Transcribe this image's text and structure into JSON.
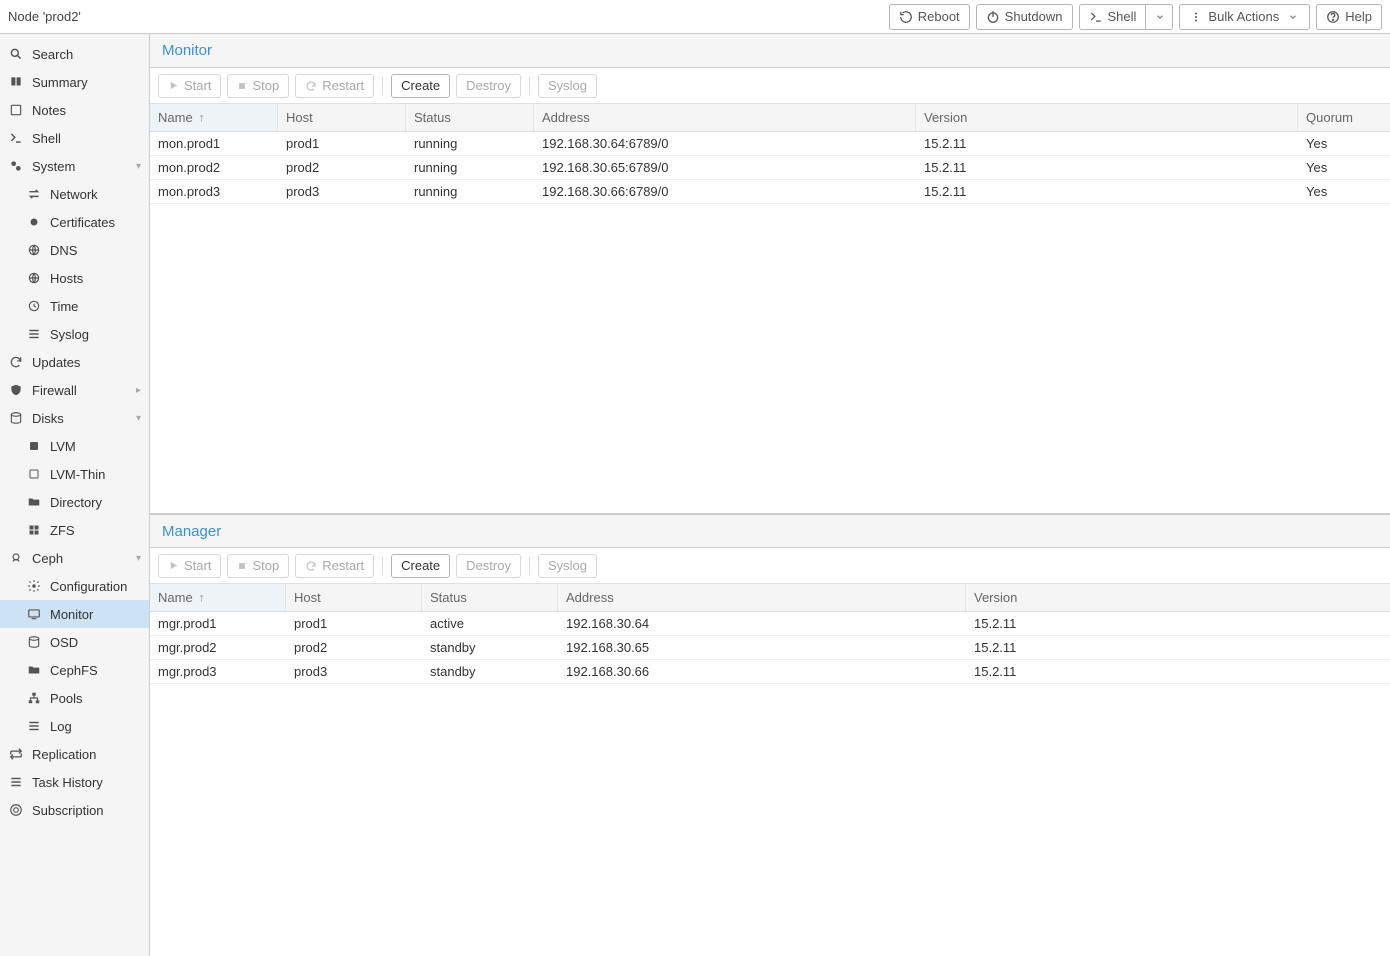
{
  "header": {
    "title": "Node 'prod2'",
    "reboot": "Reboot",
    "shutdown": "Shutdown",
    "shell": "Shell",
    "bulk": "Bulk Actions",
    "help": "Help"
  },
  "sidebar": {
    "search": "Search",
    "summary": "Summary",
    "notes": "Notes",
    "shell": "Shell",
    "system": "System",
    "network": "Network",
    "certificates": "Certificates",
    "dns": "DNS",
    "hosts": "Hosts",
    "time": "Time",
    "syslog": "Syslog",
    "updates": "Updates",
    "firewall": "Firewall",
    "disks": "Disks",
    "lvm": "LVM",
    "lvmthin": "LVM-Thin",
    "directory": "Directory",
    "zfs": "ZFS",
    "ceph": "Ceph",
    "configuration": "Configuration",
    "monitor": "Monitor",
    "osd": "OSD",
    "cephfs": "CephFS",
    "pools": "Pools",
    "log": "Log",
    "replication": "Replication",
    "taskhistory": "Task History",
    "subscription": "Subscription"
  },
  "monitor": {
    "title": "Monitor",
    "toolbar": {
      "start": "Start",
      "stop": "Stop",
      "restart": "Restart",
      "create": "Create",
      "destroy": "Destroy",
      "syslog": "Syslog"
    },
    "columns": {
      "name": "Name",
      "host": "Host",
      "status": "Status",
      "address": "Address",
      "version": "Version",
      "quorum": "Quorum"
    },
    "rows": [
      {
        "name": "mon.prod1",
        "host": "prod1",
        "status": "running",
        "address": "192.168.30.64:6789/0",
        "version": "15.2.11",
        "quorum": "Yes"
      },
      {
        "name": "mon.prod2",
        "host": "prod2",
        "status": "running",
        "address": "192.168.30.65:6789/0",
        "version": "15.2.11",
        "quorum": "Yes"
      },
      {
        "name": "mon.prod3",
        "host": "prod3",
        "status": "running",
        "address": "192.168.30.66:6789/0",
        "version": "15.2.11",
        "quorum": "Yes"
      }
    ]
  },
  "manager": {
    "title": "Manager",
    "toolbar": {
      "start": "Start",
      "stop": "Stop",
      "restart": "Restart",
      "create": "Create",
      "destroy": "Destroy",
      "syslog": "Syslog"
    },
    "columns": {
      "name": "Name",
      "host": "Host",
      "status": "Status",
      "address": "Address",
      "version": "Version"
    },
    "rows": [
      {
        "name": "mgr.prod1",
        "host": "prod1",
        "status": "active",
        "address": "192.168.30.64",
        "version": "15.2.11"
      },
      {
        "name": "mgr.prod2",
        "host": "prod2",
        "status": "standby",
        "address": "192.168.30.65",
        "version": "15.2.11"
      },
      {
        "name": "mgr.prod3",
        "host": "prod3",
        "status": "standby",
        "address": "192.168.30.66",
        "version": "15.2.11"
      }
    ]
  }
}
